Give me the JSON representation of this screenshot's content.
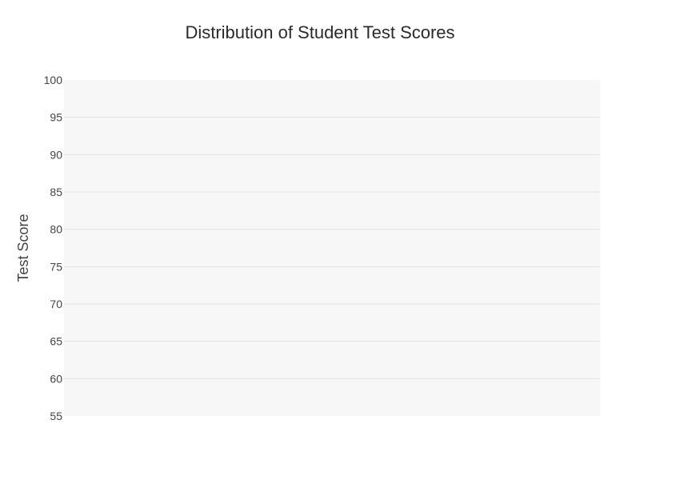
{
  "chart_data": {
    "type": "box",
    "title": "Distribution of Student Test Scores",
    "xlabel": "",
    "ylabel": "Test Score",
    "ylim": [
      55,
      100
    ],
    "yticks": [
      55,
      60,
      65,
      70,
      75,
      80,
      85,
      90,
      95,
      100
    ],
    "grid": true,
    "legend": "none",
    "series": [],
    "colors": {
      "plot_background": "#f7f7f7",
      "gridline": "#e2e2e2",
      "text": "#444444"
    }
  }
}
